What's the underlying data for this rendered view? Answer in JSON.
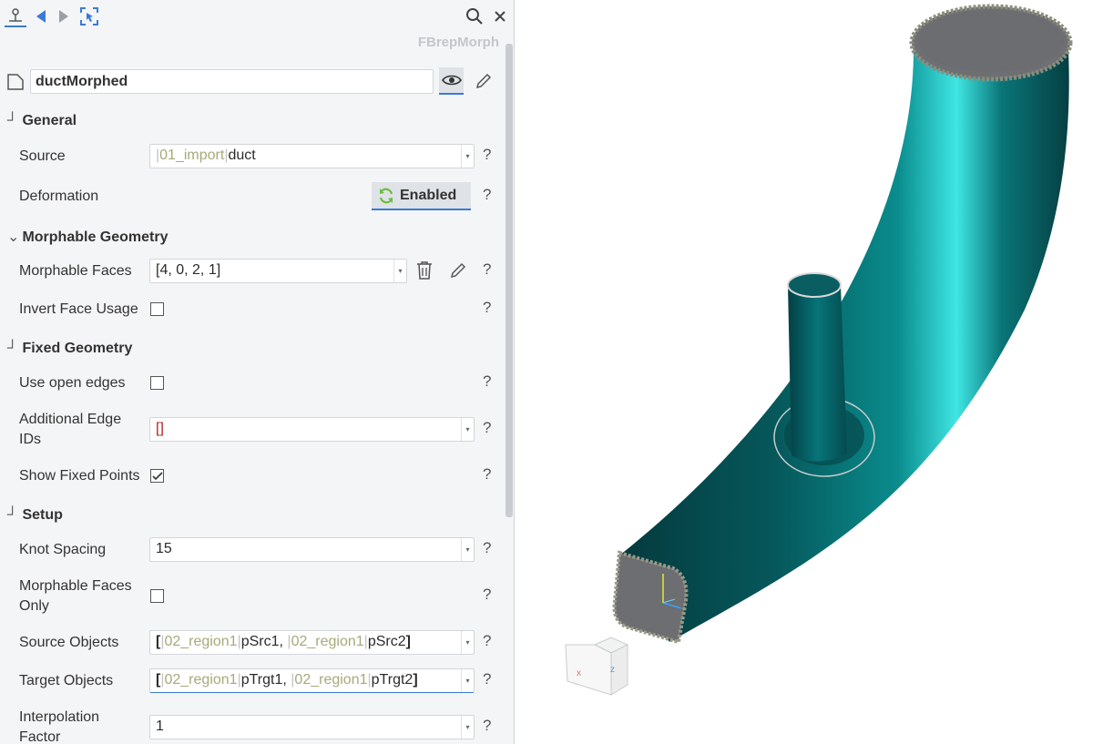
{
  "node_type": "FBrepMorph",
  "name": "ductMorphed",
  "sections": {
    "general": "General",
    "morphable_geometry": "Morphable Geometry",
    "fixed_geometry": "Fixed Geometry",
    "setup": "Setup"
  },
  "fields": {
    "source": {
      "label": "Source",
      "prefix": "01_import",
      "value": "duct"
    },
    "deformation": {
      "label": "Deformation",
      "button": "Enabled"
    },
    "morphable_faces": {
      "label": "Morphable Faces",
      "value": "[4, 0, 2, 1]"
    },
    "invert_face_usage": {
      "label": "Invert Face Usage",
      "checked": false
    },
    "use_open_edges": {
      "label": "Use open edges",
      "checked": false
    },
    "additional_edge_ids": {
      "label_line1": "Additional Edge",
      "label_line2": "IDs",
      "value": "[]"
    },
    "show_fixed_points": {
      "label": "Show Fixed Points",
      "checked": true
    },
    "knot_spacing": {
      "label": "Knot Spacing",
      "value": "15"
    },
    "morphable_faces_only": {
      "label_line1": "Morphable Faces",
      "label_line2": "Only",
      "checked": false
    },
    "source_objects": {
      "label": "Source Objects",
      "region": "02_region1",
      "obj1": "pSrc1,",
      "obj2": "pSrc2"
    },
    "target_objects": {
      "label": "Target Objects",
      "region": "02_region1",
      "obj1": "pTrgt1,",
      "obj2": "pTrgt2"
    },
    "interpolation_factor": {
      "label_line1": "Interpolation",
      "label_line2": "Factor",
      "value": "1"
    }
  },
  "help_glyph": "?",
  "bracket_open": "[",
  "bracket_close": "]",
  "colors": {
    "accent": "#3a7bd5",
    "duct": "#0b5f63",
    "panel_bg": "#f4f5f7"
  }
}
